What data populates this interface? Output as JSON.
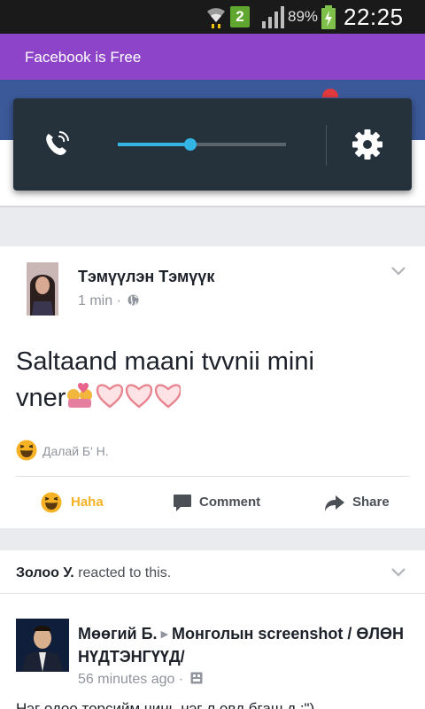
{
  "status_bar": {
    "sim_slot": "2",
    "battery_percent": "89%",
    "time": "22:25",
    "icons": [
      "wifi-icon",
      "signal-icon",
      "battery-charging-icon"
    ]
  },
  "banner": {
    "text": "Facebook is Free",
    "color": "#8e44c9"
  },
  "volume_popup": {
    "level": 0.43,
    "icons": [
      "call-volume-icon",
      "settings-gear-icon"
    ],
    "accent": "#33b5e5"
  },
  "post": {
    "author": "Тэмүүлэн Тэмүүк",
    "time": "1 min",
    "separator": "·",
    "text_line1": "Saltaand maani tvvnii mini",
    "text_line2": "vner",
    "reaction_by": "Далай Б' Н.",
    "actions": {
      "haha": "Haha",
      "comment": "Comment",
      "share": "Share"
    }
  },
  "reaction_notice": {
    "name": "Золоо У.",
    "text": "reacted to this."
  },
  "post2": {
    "author": "Мөөгий Б.",
    "group": "Монголын screenshot / ӨЛӨН НҮДТЭНГҮҮД/",
    "time": "56 minutes ago",
    "separator": "·",
    "text": "Нэг одоо торсийм чинь нэг л овд бгаш д ;\")"
  },
  "colors": {
    "fb_blue": "#3b5998",
    "haha_yellow": "#f7b125",
    "muted": "#90949c"
  }
}
